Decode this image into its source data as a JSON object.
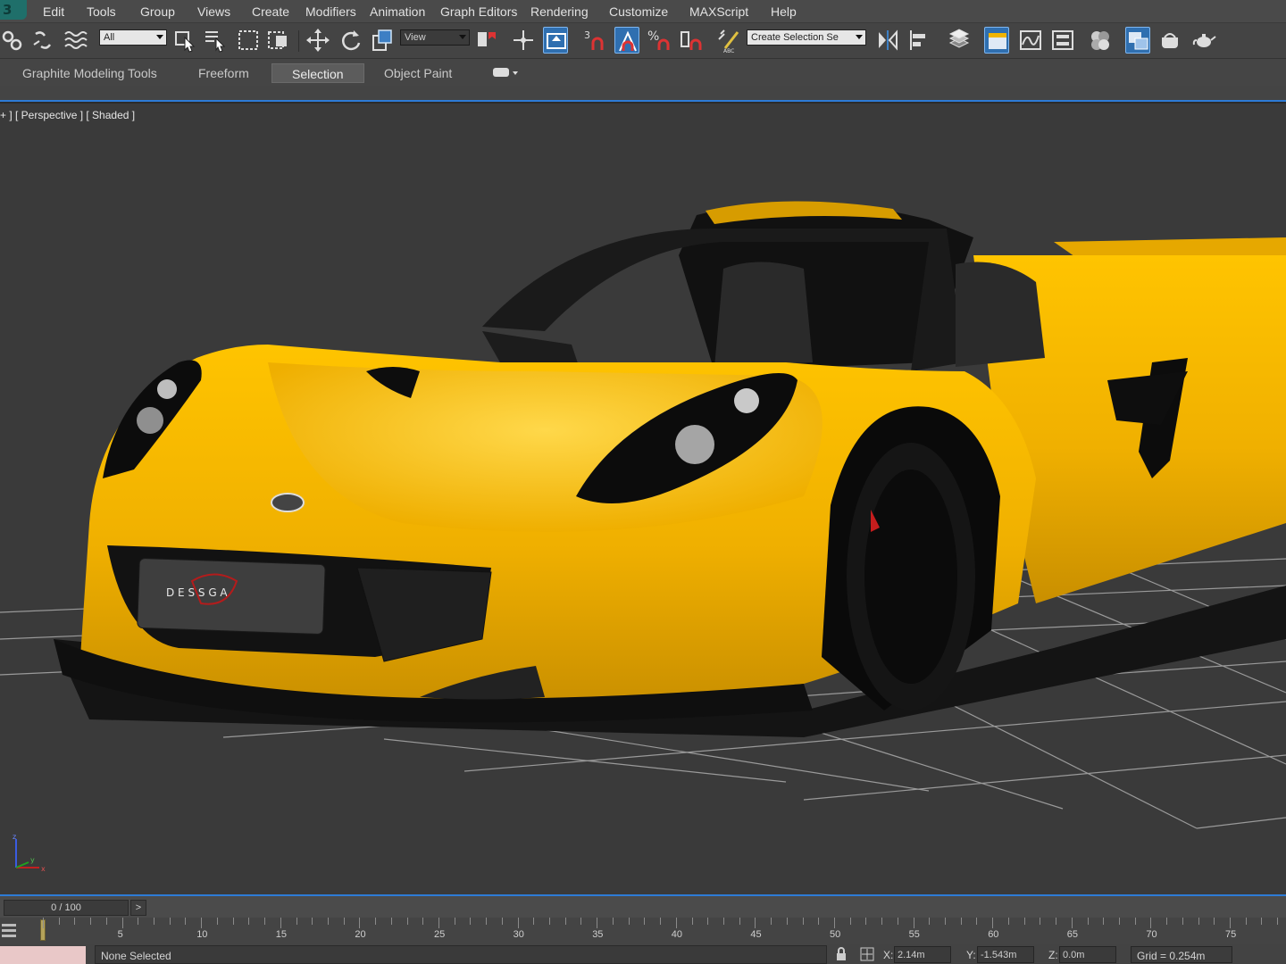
{
  "menubar": {
    "items": [
      "Edit",
      "Tools",
      "Group",
      "Views",
      "Create",
      "Modifiers",
      "Animation",
      "Graph Editors",
      "Rendering",
      "Customize",
      "MAXScript",
      "Help"
    ]
  },
  "toolbar": {
    "selection_filter": "All",
    "reference_coord": "View",
    "named_selection": "Create Selection Se"
  },
  "ribbon": {
    "tabs": [
      "Graphite Modeling Tools",
      "Freeform",
      "Selection",
      "Object Paint"
    ],
    "active_tab": "Selection"
  },
  "viewport": {
    "label": "+ ] [ Perspective ] [ Shaded ]",
    "plate_text": "D E S S G A",
    "axis_z": "z",
    "axis_y": "y",
    "axis_x": "x"
  },
  "timeline": {
    "frame_display": "0 / 100",
    "next_label": ">",
    "ticks": [
      "5",
      "10",
      "15",
      "20",
      "25",
      "30",
      "35",
      "40",
      "45",
      "50",
      "55",
      "60",
      "65",
      "70",
      "75"
    ]
  },
  "status": {
    "selection_text": "None Selected",
    "x_label": "X:",
    "x_value": "2.14m",
    "y_label": "Y:",
    "y_value": "-1.543m",
    "z_label": "Z:",
    "z_value": "0.0m",
    "grid": "Grid = 0.254m"
  },
  "colors": {
    "accent": "#2d7bd6",
    "car_body": "#f0b400",
    "viewport_bg": "#3a3a3a"
  }
}
